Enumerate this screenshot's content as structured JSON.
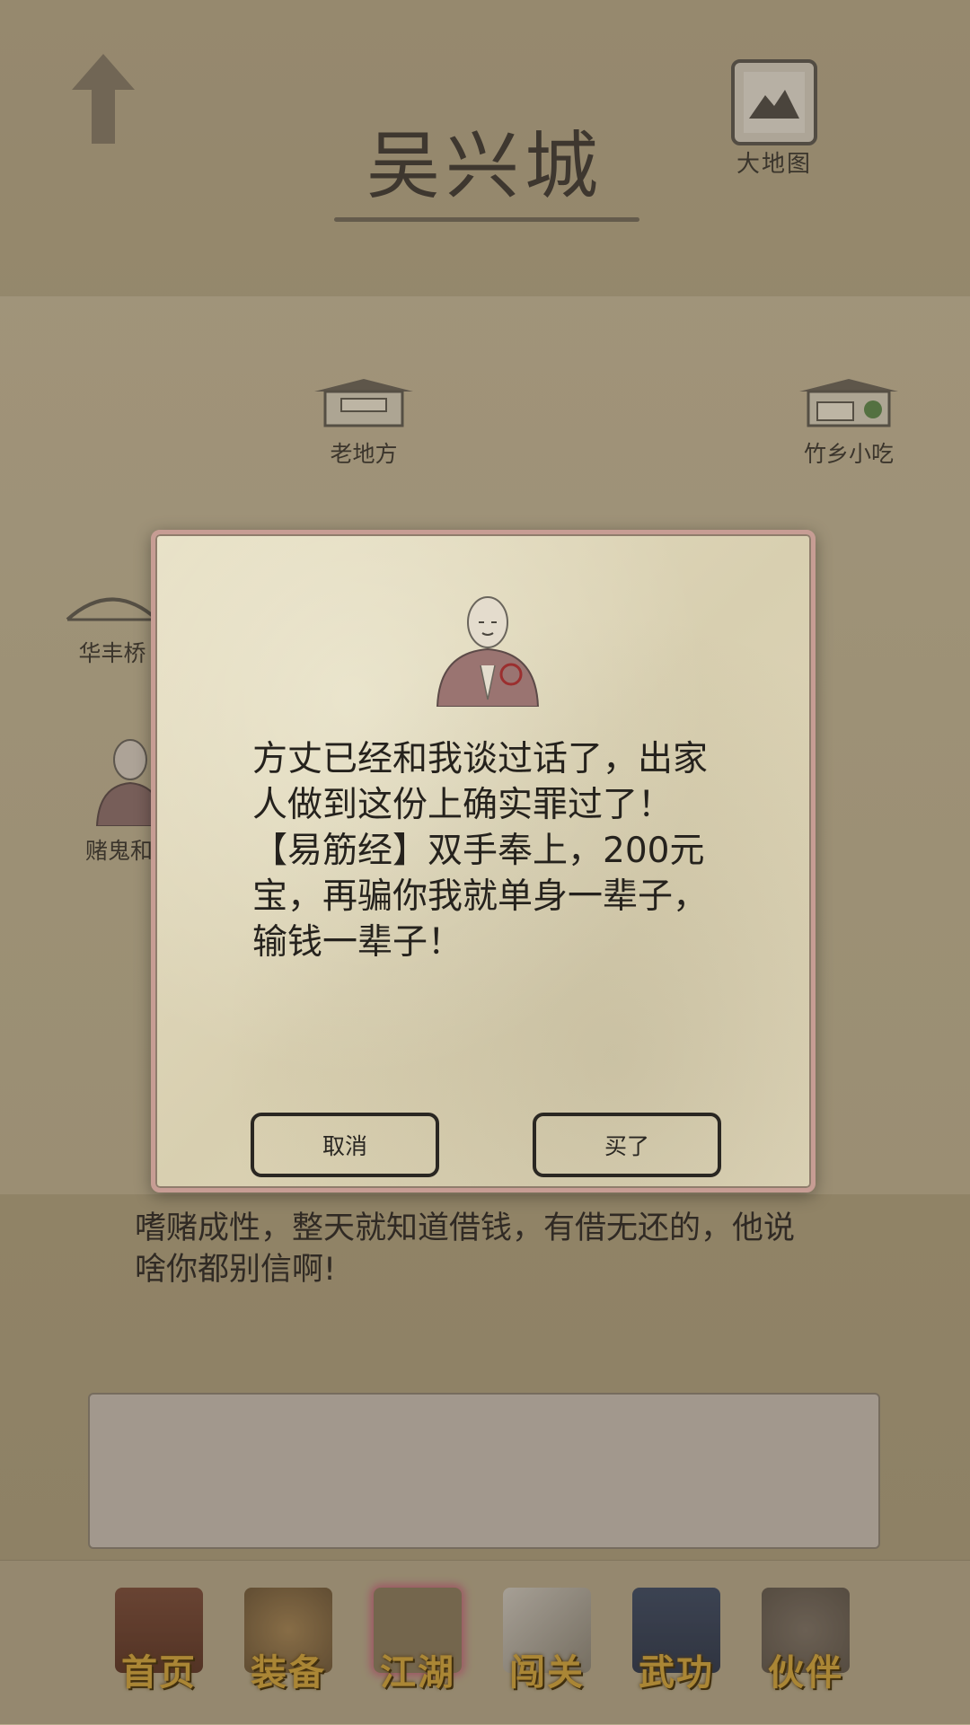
{
  "header": {
    "city_name": "吴兴城",
    "map_button_label": "大地图"
  },
  "locations": [
    {
      "label": "老地方",
      "icon": "building-icon"
    },
    {
      "label": "竹乡小吃",
      "icon": "shop-icon"
    },
    {
      "label": "华丰桥",
      "icon": "bridge-icon"
    },
    {
      "label": "赌鬼和尚",
      "icon": "monk-icon"
    }
  ],
  "description": "嗜赌成性，整天就知道借钱，有借无还的，他说啥你都别信啊!",
  "dialog": {
    "text": "方丈已经和我谈过话了，出家人做到这份上确实罪过了！【易筋经】双手奉上，200元宝，再骗你我就单身一辈子，输钱一辈子！",
    "cancel_label": "取消",
    "confirm_label": "买了"
  },
  "tabbar": {
    "tabs": [
      {
        "label": "首页",
        "icon": "temple-icon"
      },
      {
        "label": "装备",
        "icon": "armor-icon"
      },
      {
        "label": "江湖",
        "icon": "scroll-icon",
        "active": true
      },
      {
        "label": "闯关",
        "icon": "swords-icon"
      },
      {
        "label": "武功",
        "icon": "book-icon"
      },
      {
        "label": "伙伴",
        "icon": "companions-icon"
      }
    ]
  },
  "colors": {
    "tab_label_gold": "#d5a73b",
    "dialog_border": "#c79d94"
  }
}
